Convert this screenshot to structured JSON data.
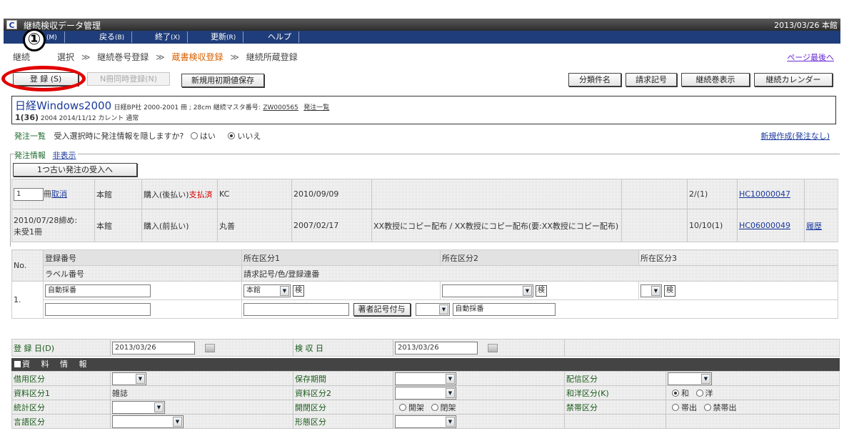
{
  "titlebar": {
    "logo": "C",
    "title": "継続検収データ管理",
    "datetime": "2013/03/26 本館"
  },
  "menu": [
    {
      "label": "",
      "key": "(M)"
    },
    {
      "label": "戻る",
      "key": "(B)"
    },
    {
      "label": "終了",
      "key": "(X)"
    },
    {
      "label": "更新",
      "key": "(R)"
    },
    {
      "label": "ヘルプ",
      "key": ""
    }
  ],
  "breadcrumb": {
    "items": [
      "継続",
      "選択",
      "継続巻号登録",
      "蔵書検収登録",
      "継続所蔵登録"
    ],
    "sep": "≫",
    "page_end": "ページ最後へ"
  },
  "annotation": {
    "number": "①"
  },
  "toolbar": {
    "register": "登 録 (S)",
    "simultaneous": "N冊同時登録(N)",
    "save_default": "新規用初期値保存",
    "classification": "分類件名",
    "call_number": "請求記号",
    "show_volumes": "継続巻表示",
    "calendar": "継続カレンダー"
  },
  "title_box": {
    "title": "日経Windows2000",
    "meta": "日経BP社 2000-2001 冊 ; 28cm 継続マスタ番号:",
    "master_no": "ZW000565",
    "order_list": "発注一覧",
    "volume": "1(36)",
    "volume_meta": "2004 2014/11/12 カレント 通常"
  },
  "order_line": {
    "label": "発注一覧",
    "question": "受入選択時に発注情報を隠しますか?",
    "yes": "はい",
    "no": "いいえ",
    "new_create": "新規作成(発注なし)"
  },
  "order_info": {
    "legend": "発注情報",
    "hide": "非表示",
    "prev_button": "1つ古い発注の受入へ",
    "rows": [
      {
        "qty": "1",
        "unit": "冊",
        "cancel": "取消",
        "library": "本館",
        "type": "購入(後払い)",
        "status": "支払済",
        "vendor": "KC",
        "date": "2010/09/09",
        "note": "",
        "blank": "",
        "count": "2/(1)",
        "order_no": "HC10000047",
        "history": ""
      },
      {
        "qty": "2010/07/28締め:",
        "unit": "未受1冊",
        "cancel": "",
        "library": "本館",
        "type": "購入(前払い)",
        "status": "",
        "vendor": "丸善",
        "date": "2007/02/17",
        "note": "XX教授にコピー配布 / XX教授にコピー配布(要:XX教授にコピー配布)",
        "blank": "",
        "count": "10/10(1)",
        "order_no": "HC06000049",
        "history": "履歴"
      }
    ]
  },
  "registration": {
    "col_no": "No.",
    "h_reg_no": "登録番号",
    "h_loc1": "所在区分1",
    "h_loc2": "所在区分2",
    "h_loc3": "所在区分3",
    "h_label_no": "ラベル番号",
    "h_call": "請求記号/色/登録連番",
    "row_no": "1.",
    "reg_no_value": "自動採番",
    "loc1_value": "本館",
    "search": "検",
    "author_button": "著者記号付与",
    "serial_value": "自動採番"
  },
  "dates": {
    "reg_label": "登 録 日(D)",
    "reg_value": "2013/03/26",
    "insp_label": "検 収 日",
    "insp_value": "2013/03/26"
  },
  "info": {
    "header": "資 料 情 報",
    "rows": [
      {
        "l1": "借用区分",
        "l2": "保存期間",
        "l3": "配信区分"
      },
      {
        "l1": "資料区分1",
        "v1": "雑誌",
        "l2": "資料区分2",
        "l3": "和洋区分(K)",
        "r_a": "和",
        "r_b": "洋"
      },
      {
        "l1": "統計区分",
        "l2": "開閉区分",
        "o_a": "開架",
        "o_b": "閉架",
        "l3": "禁帯区分",
        "r_c": "帯出",
        "r_d": "禁帯出"
      },
      {
        "l1": "言語区分",
        "l2": "形態区分"
      }
    ]
  }
}
